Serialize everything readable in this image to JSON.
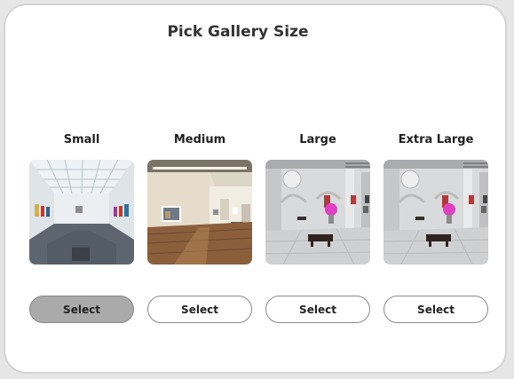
{
  "title": "Pick Gallery Size",
  "options": [
    {
      "label": "Small",
      "button": "Select",
      "selected": true
    },
    {
      "label": "Medium",
      "button": "Select",
      "selected": false
    },
    {
      "label": "Large",
      "button": "Select",
      "selected": false
    },
    {
      "label": "Extra Large",
      "button": "Select",
      "selected": false
    }
  ],
  "colors": {
    "selected_button": "#aaaaaa",
    "button_border": "#8a8a8a",
    "text": "#222222"
  }
}
